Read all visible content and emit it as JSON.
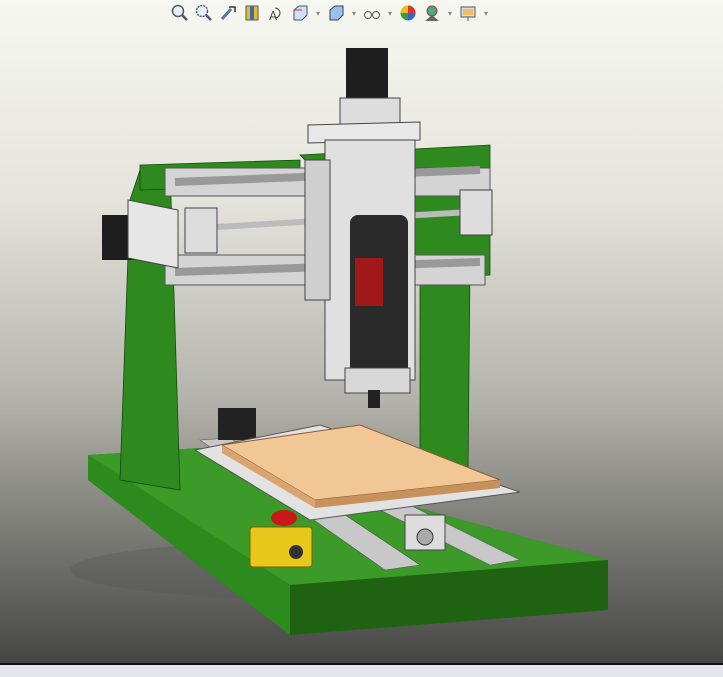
{
  "toolbar": {
    "items": [
      {
        "icon": "zoom-to-fit-icon"
      },
      {
        "icon": "zoom-to-area-icon"
      },
      {
        "icon": "previous-view-icon"
      },
      {
        "icon": "section-view-icon"
      },
      {
        "icon": "dynamic-annotation-views-icon"
      },
      {
        "icon": "view-orientation-icon",
        "dropdown": true
      },
      {
        "icon": "display-style-icon",
        "dropdown": true
      },
      {
        "icon": "hide-show-items-icon",
        "dropdown": true
      },
      {
        "icon": "edit-appearance-icon"
      },
      {
        "icon": "apply-scene-icon",
        "dropdown": true
      },
      {
        "icon": "view-settings-icon",
        "dropdown": true
      }
    ]
  },
  "colors": {
    "frame": "#2e7d1e",
    "wood": "#f0c090",
    "aluminium": "#d8d8d8",
    "motor": "#222222",
    "estop": "#e8c81a"
  }
}
